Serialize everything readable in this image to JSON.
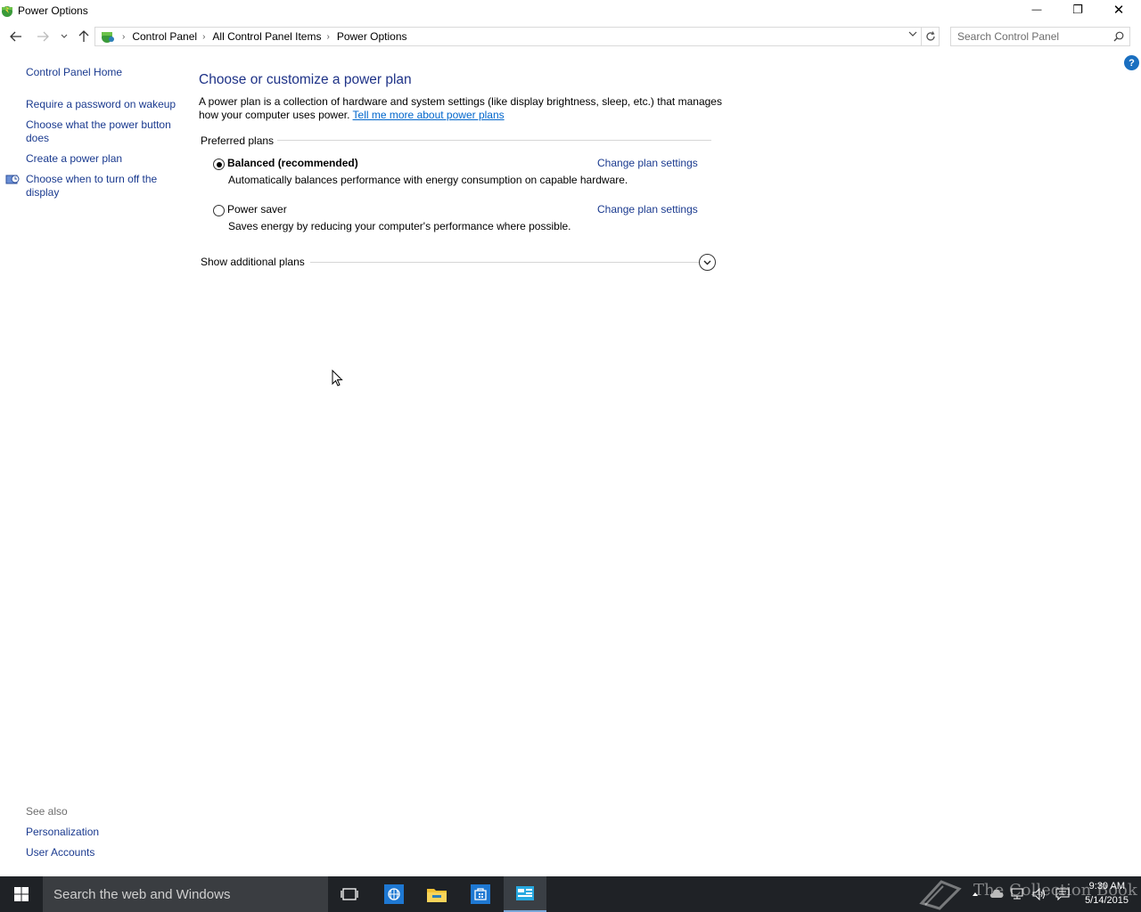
{
  "window": {
    "title": "Power Options",
    "minimize_glyph": "—",
    "maximize_glyph": "❐",
    "close_glyph": "✕"
  },
  "nav": {
    "breadcrumb": [
      "Control Panel",
      "All Control Panel Items",
      "Power Options"
    ],
    "search_placeholder": "Search Control Panel"
  },
  "help": {
    "glyph": "?"
  },
  "sidebar": {
    "home": "Control Panel Home",
    "links": [
      "Require a password on wakeup",
      "Choose what the power button does",
      "Create a power plan",
      "Choose when to turn off the display"
    ],
    "see_also_title": "See also",
    "see_also": [
      "Personalization",
      "User Accounts"
    ]
  },
  "main": {
    "title": "Choose or customize a power plan",
    "description": "A power plan is a collection of hardware and system settings (like display brightness, sleep, etc.) that manages how your computer uses power.",
    "description_link": "Tell me more about power plans",
    "preferred_plans_header": "Preferred plans",
    "plans": [
      {
        "name": "Balanced (recommended)",
        "description": "Automatically balances performance with energy consumption on capable hardware.",
        "selected": true,
        "change_link": "Change plan settings"
      },
      {
        "name": "Power saver",
        "description": "Saves energy by reducing your computer's performance where possible.",
        "selected": false,
        "change_link": "Change plan settings"
      }
    ],
    "show_additional": "Show additional plans"
  },
  "taskbar": {
    "search_text": "Search the web and Windows",
    "time": "9:30 AM",
    "date": "5/14/2015",
    "watermark": "The Collection Book"
  },
  "colors": {
    "link": "#1a3a8f",
    "title_blue": "#1e3287",
    "taskbar_bg": "#1f2226"
  }
}
